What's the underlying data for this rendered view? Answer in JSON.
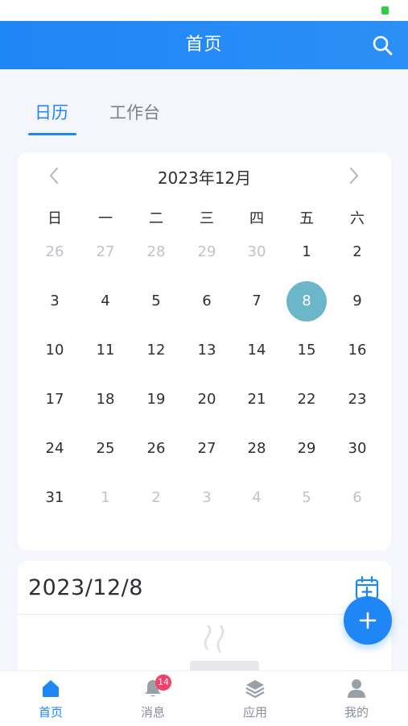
{
  "header": {
    "title": "首页"
  },
  "tabs": [
    {
      "label": "日历"
    },
    {
      "label": "工作台"
    }
  ],
  "calendar": {
    "month_label": "2023年12月",
    "weekdays": [
      "日",
      "一",
      "二",
      "三",
      "四",
      "五",
      "六"
    ],
    "weeks": [
      [
        {
          "d": "26",
          "m": true
        },
        {
          "d": "27",
          "m": true
        },
        {
          "d": "28",
          "m": true
        },
        {
          "d": "29",
          "m": true
        },
        {
          "d": "30",
          "m": true
        },
        {
          "d": "1"
        },
        {
          "d": "2"
        }
      ],
      [
        {
          "d": "3"
        },
        {
          "d": "4"
        },
        {
          "d": "5"
        },
        {
          "d": "6"
        },
        {
          "d": "7"
        },
        {
          "d": "8",
          "sel": true
        },
        {
          "d": "9"
        }
      ],
      [
        {
          "d": "10"
        },
        {
          "d": "11"
        },
        {
          "d": "12"
        },
        {
          "d": "13"
        },
        {
          "d": "14"
        },
        {
          "d": "15"
        },
        {
          "d": "16"
        }
      ],
      [
        {
          "d": "17"
        },
        {
          "d": "18"
        },
        {
          "d": "19"
        },
        {
          "d": "20"
        },
        {
          "d": "21"
        },
        {
          "d": "22"
        },
        {
          "d": "23"
        }
      ],
      [
        {
          "d": "24"
        },
        {
          "d": "25"
        },
        {
          "d": "26"
        },
        {
          "d": "27"
        },
        {
          "d": "28"
        },
        {
          "d": "29"
        },
        {
          "d": "30"
        }
      ],
      [
        {
          "d": "31"
        },
        {
          "d": "1",
          "m": true
        },
        {
          "d": "2",
          "m": true
        },
        {
          "d": "3",
          "m": true
        },
        {
          "d": "4",
          "m": true
        },
        {
          "d": "5",
          "m": true
        },
        {
          "d": "6",
          "m": true
        }
      ]
    ]
  },
  "selected_date": {
    "label": "2023/12/8"
  },
  "bottom_nav": [
    {
      "label": "首页",
      "icon": "home-icon"
    },
    {
      "label": "消息",
      "icon": "bell-icon",
      "badge": "14"
    },
    {
      "label": "应用",
      "icon": "layers-icon"
    },
    {
      "label": "我的",
      "icon": "user-icon"
    }
  ],
  "colors": {
    "accent": "#1f86f5",
    "selected_day": "#6bb6c8",
    "badge": "#f0426b"
  }
}
